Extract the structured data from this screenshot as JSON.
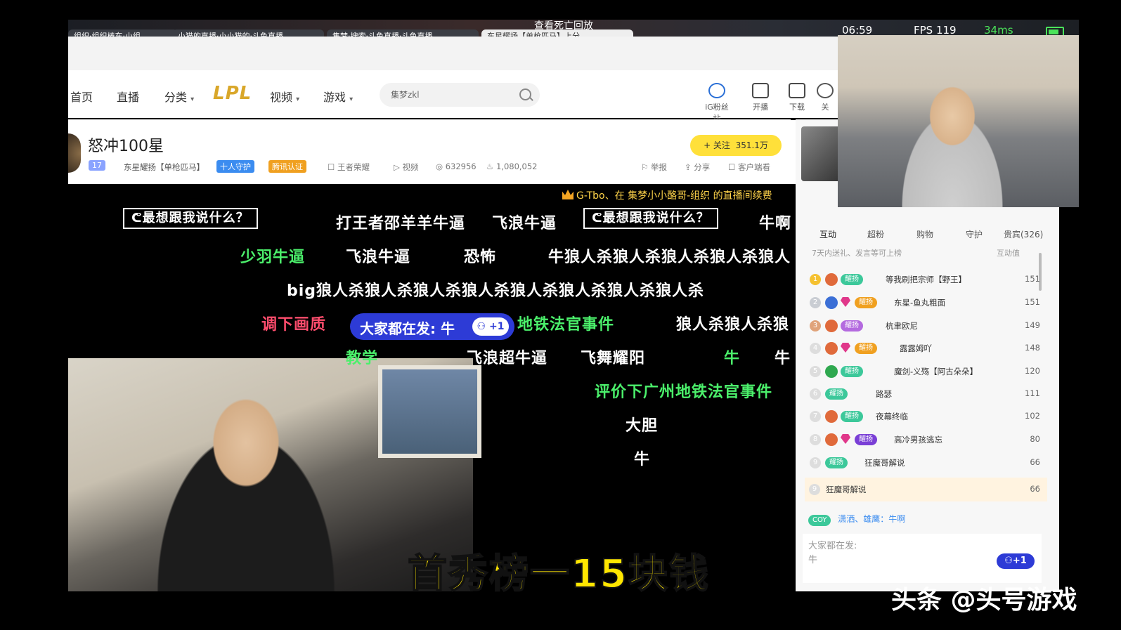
{
  "status": {
    "banner": "查看死亡回放",
    "time": "06:59",
    "fps": "FPS 119",
    "ping": "34ms"
  },
  "tabs": [
    "组织·组织棒东·小组",
    "小猫的直播·小小猫的·斗鱼直播",
    "集梦·搜索·斗鱼直播·斗鱼直播",
    "东星耀扬【单枪匹马】上分"
  ],
  "nav": {
    "home": "首页",
    "live": "直播",
    "category": "分类",
    "lpl": "LPL",
    "video": "视频",
    "game": "游戏"
  },
  "search": {
    "value": "集梦zkl"
  },
  "top_icons": [
    {
      "label": "iG粉丝站",
      "icon": "ig-fan-icon"
    },
    {
      "label": "开播",
      "icon": "camera-icon"
    },
    {
      "label": "下载",
      "icon": "download-icon"
    },
    {
      "label": "关",
      "icon": "heart-icon"
    }
  ],
  "room": {
    "title": "怒冲100星",
    "level": "17",
    "name": "东星耀扬【单枪匹马】",
    "badge_guard": "十人守护",
    "badge_cert": "腾讯认证",
    "game": "王者荣耀",
    "video": "视频",
    "viewers": "632956",
    "hot": "1,080,052",
    "follow_label": "+ 关注",
    "follow_count": "351.1万",
    "report": "举报",
    "share": "分享",
    "client": "客户端看"
  },
  "player": {
    "gift_notice": "G-Tbo、在 集梦小小酪哥-组织 的直播间续费",
    "danmaku": [
      {
        "text": "ᕦ最想跟我说什么？",
        "style": "box"
      },
      {
        "text": "打王者邵羊羊牛逼",
        "style": "white"
      },
      {
        "text": "飞浪牛逼",
        "style": "white"
      },
      {
        "text": "ᕦ最想跟我说什么？",
        "style": "box"
      },
      {
        "text": "牛啊",
        "style": "white"
      },
      {
        "text": "少羽牛逼",
        "style": "green"
      },
      {
        "text": "飞浪牛逼",
        "style": "white"
      },
      {
        "text": "恐怖",
        "style": "white"
      },
      {
        "text": "牛狼人杀狼人杀狼人杀狼人杀狼人",
        "style": "white"
      },
      {
        "text": "big狼人杀狼人杀狼人杀狼人杀狼人杀狼人杀狼人杀狼人杀",
        "style": "white"
      },
      {
        "text": "调下画质",
        "style": "red"
      },
      {
        "text": "地铁法官事件",
        "style": "green"
      },
      {
        "text": "狼人杀狼人杀狼",
        "style": "white"
      },
      {
        "text": "教学",
        "style": "green"
      },
      {
        "text": "飞浪超牛逼",
        "style": "white"
      },
      {
        "text": "飞舞耀阳",
        "style": "white"
      },
      {
        "text": "牛",
        "style": "green"
      },
      {
        "text": "牛",
        "style": "white"
      },
      {
        "text": "评价下广州地铁法官事件",
        "style": "green"
      },
      {
        "text": "大胆",
        "style": "white"
      },
      {
        "text": "牛",
        "style": "white"
      }
    ],
    "quick_pill": "大家都在发: 牛",
    "plus_one": "+1",
    "caption": "首秀榜一15块钱"
  },
  "sidebar": {
    "tabs": [
      "互动",
      "超粉",
      "购物",
      "守护",
      "贵宾(326)"
    ],
    "sub_left": "7天内送礼、发言等可上榜",
    "sub_right": "互动值",
    "rows": [
      {
        "rank": "1",
        "fan": "耀扬",
        "nick": "等我刷把宗师【野王】",
        "score": "151"
      },
      {
        "rank": "2",
        "fan": "耀扬",
        "nick": "东星-鱼丸粗面",
        "score": "151"
      },
      {
        "rank": "3",
        "fan": "耀扬",
        "nick": "杭聿欧尼",
        "score": "149"
      },
      {
        "rank": "4",
        "fan": "耀扬",
        "nick": "露露姆吖",
        "score": "148"
      },
      {
        "rank": "5",
        "fan": "耀扬",
        "nick": "魔剑-义殇【阿古朵朵】",
        "score": "120"
      },
      {
        "rank": "6",
        "fan": "耀扬",
        "nick": "路瑟",
        "score": "111"
      },
      {
        "rank": "7",
        "fan": "耀扬",
        "nick": "夜幕终临",
        "score": "102"
      },
      {
        "rank": "8",
        "fan": "耀扬",
        "nick": "高冷男孩逃忘",
        "score": "80"
      },
      {
        "rank": "9",
        "fan": "耀扬",
        "nick": "狂魔哥解说",
        "score": "66"
      }
    ],
    "my_rank": "9",
    "my_nick": "狂魔哥解说",
    "my_score": "66",
    "chat_badge": "COY",
    "chat_text": "潇洒、雄鹰：牛啊",
    "input_label": "大家都在发:",
    "input_value": "牛",
    "send_plus": "+1"
  },
  "watermark": "头条 @头号游戏"
}
